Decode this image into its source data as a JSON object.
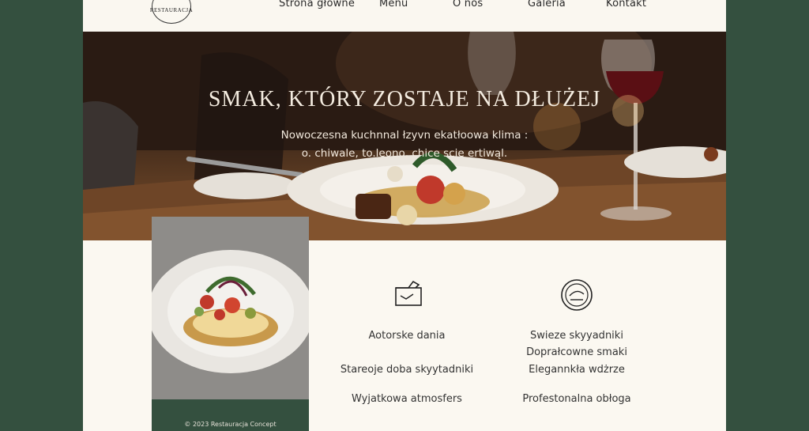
{
  "header": {
    "logo_text": "RESTAURACJA",
    "nav": [
      "Strona główne",
      "Menu",
      "O nos",
      "Galeria",
      "Kontakt"
    ]
  },
  "hero": {
    "title": "SMAK, KTÓRY ZOSTAJE NA DŁUŻEJ",
    "subtitle_line1": "Nowoczesna kuchnnal łzyvn ekatłoowa klima :",
    "subtitle_line2": "o. chiwale, to.leono, chice scie ertiwąl."
  },
  "features": {
    "left": [
      "Aotorske dania",
      "Stareoje doba skyytadniki",
      "Wyjatkowa atmosfers"
    ],
    "right": [
      "Swieze skyyadniki",
      "Doprałcowne smaki",
      "Elegannkła wdżrze",
      "Profestonalna obłoga"
    ]
  },
  "footer": {
    "copyright": "© 2023 Restauracja Concept"
  },
  "colors": {
    "page_bg": "#fbf8f1",
    "frame_bg": "#34503f",
    "text": "#333333"
  }
}
